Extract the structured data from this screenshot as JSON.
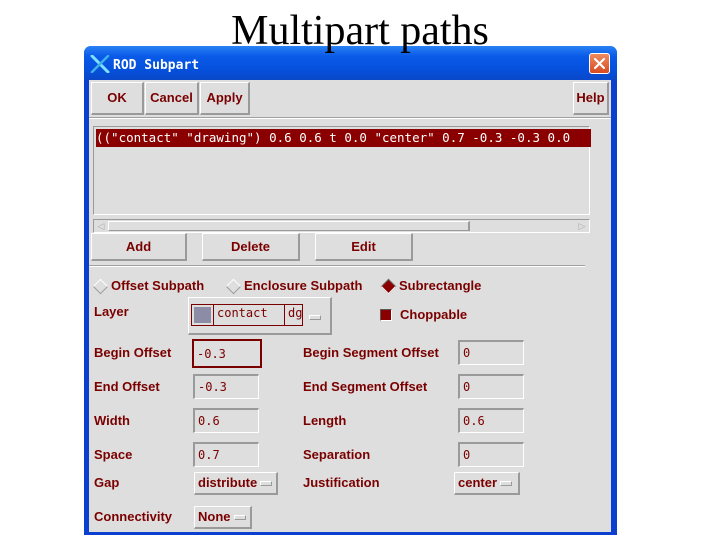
{
  "slide": {
    "title": "Multipart paths"
  },
  "window": {
    "title": "ROD Subpart",
    "icons": {
      "app": "x-logo-icon",
      "close": "close-icon"
    }
  },
  "toolbar": {
    "ok": "OK",
    "cancel": "Cancel",
    "apply": "Apply",
    "help": "Help"
  },
  "subparts_list": {
    "items": [
      "((\"contact\" \"drawing\") 0.6 0.6 t 0.0 \"center\" 0.7 -0.3 -0.3 0.0"
    ],
    "selected_index": 0,
    "scroll_left_icon": "scroll-left-arrow-icon",
    "scroll_right_icon": "scroll-right-arrow-icon"
  },
  "list_actions": {
    "add": "Add",
    "delete": "Delete",
    "edit": "Edit"
  },
  "subpart_type": {
    "options": [
      "Offset Subpath",
      "Enclosure Subpath",
      "Subrectangle"
    ],
    "selected": "Subrectangle"
  },
  "form": {
    "layer": {
      "label": "Layer",
      "name": "contact",
      "purpose": "dg",
      "swatch_color": "#8c8ca6"
    },
    "choppable": {
      "label": "Choppable",
      "checked": true
    },
    "begin_offset": {
      "label": "Begin Offset",
      "value": "-0.3"
    },
    "begin_segment_offset": {
      "label": "Begin Segment Offset",
      "value": "0"
    },
    "end_offset": {
      "label": "End Offset",
      "value": "-0.3"
    },
    "end_segment_offset": {
      "label": "End Segment Offset",
      "value": "0"
    },
    "width": {
      "label": "Width",
      "value": "0.6"
    },
    "length": {
      "label": "Length",
      "value": "0.6"
    },
    "space": {
      "label": "Space",
      "value": "0.7"
    },
    "separation": {
      "label": "Separation",
      "value": "0"
    },
    "gap": {
      "label": "Gap",
      "value": "distribute"
    },
    "justification": {
      "label": "Justification",
      "value": "center"
    },
    "connectivity": {
      "label": "Connectivity",
      "value": "None"
    }
  },
  "colors": {
    "title_bar": "#0a5ae8",
    "window_border": "#0a3fd0",
    "text_accent": "#7a0000",
    "selection": "#8a0000",
    "background": "#dedede"
  }
}
